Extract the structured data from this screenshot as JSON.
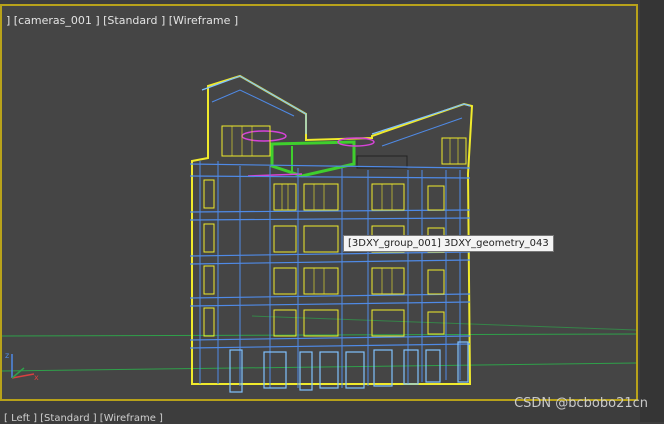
{
  "viewport": {
    "label": "] [cameras_001 ] [Standard ] [Wireframe ]",
    "tooltip": "[3DXY_group_001] 3DXY_geometry_043",
    "colors": {
      "active_border": "#b8a21a",
      "wireframe_blue": "#4f8ae6",
      "wireframe_light": "#7fc1ff",
      "selection_yellow": "#f0ea2c",
      "geometry_green": "#3fcf2d",
      "accent_magenta": "#d743d8",
      "grid_green": "#2fa04a"
    }
  },
  "bottom_viewport": {
    "label": "[ Left ] [Standard ] [Wireframe ]"
  },
  "watermark": "CSDN @bcbobo21cn",
  "axis_gizmo": {
    "icon": "xyz-axis-icon"
  }
}
